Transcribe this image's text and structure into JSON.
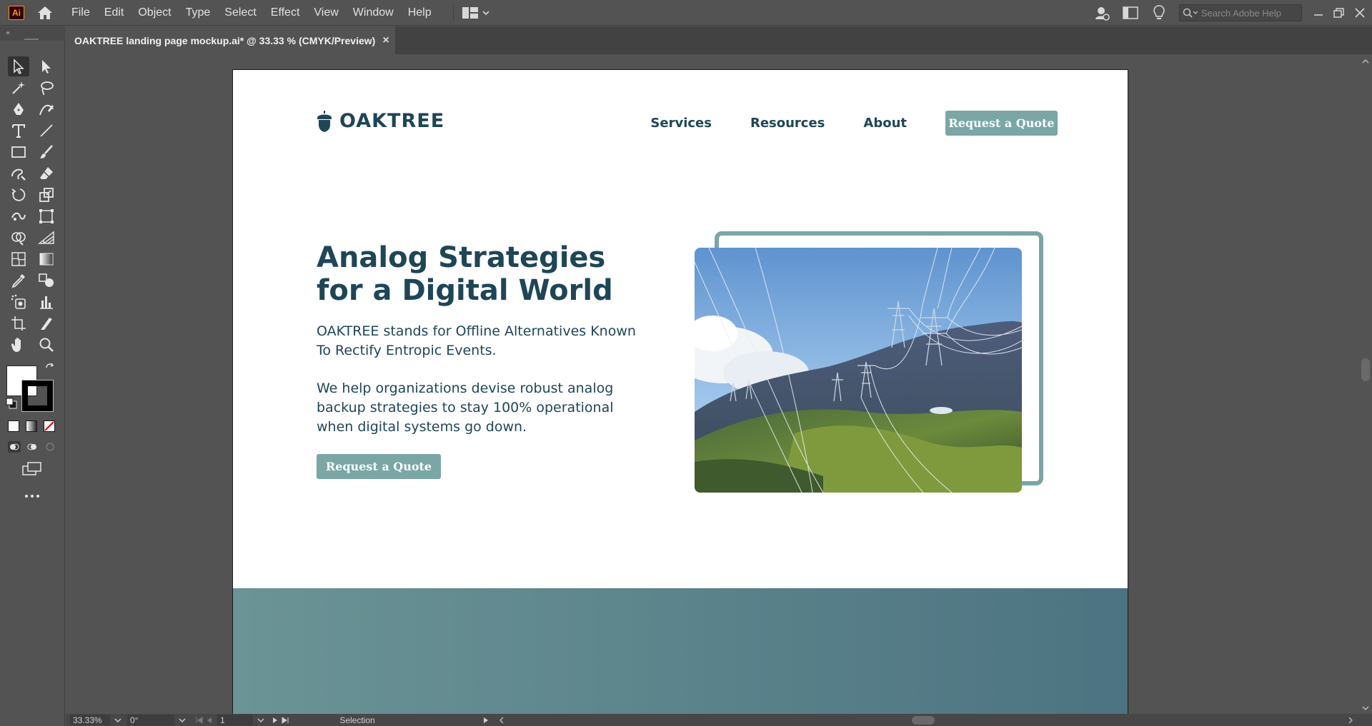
{
  "app": {
    "logo_text": "Ai",
    "menu": [
      "File",
      "Edit",
      "Object",
      "Type",
      "Select",
      "Effect",
      "View",
      "Window",
      "Help"
    ],
    "search_placeholder": "Search Adobe Help"
  },
  "document": {
    "tab_title": "OAKTREE landing page mockup.ai* @ 33.33 % (CMYK/Preview)",
    "close_glyph": "×"
  },
  "artboard": {
    "logo_text": "OAKTREE",
    "nav": [
      "Services",
      "Resources",
      "About"
    ],
    "nav_button": "Request a Quote",
    "headline": "Analog Strategies for a Digital World",
    "subheadline": "OAKTREE stands for Offline Alternatives Known To Rectify Entropic Events.",
    "body": "We help organizations devise robust analog backup strategies to stay 100% operational when digital systems go down.",
    "cta": "Request a Quote",
    "colors": {
      "brand_dark": "#1d4657",
      "accent": "#7aa6a6"
    }
  },
  "status": {
    "zoom": "33.33%",
    "rotation": "0°",
    "artboard_num": "1",
    "tool": "Selection"
  }
}
